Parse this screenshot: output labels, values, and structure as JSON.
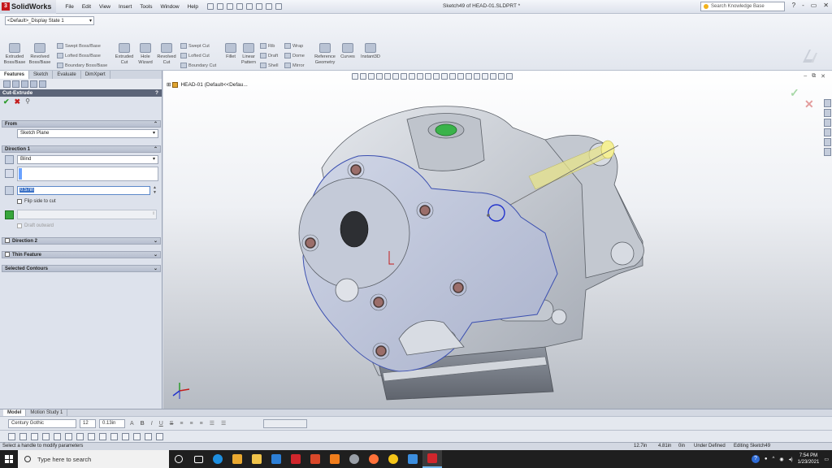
{
  "app": {
    "brand": "SolidWorks",
    "document_title": "Sketch49 of HEAD-01.SLDPRT *",
    "menu": [
      "File",
      "Edit",
      "View",
      "Insert",
      "Tools",
      "Window",
      "Help"
    ],
    "search_placeholder": "Search Knowledge Base",
    "window_controls": [
      "?",
      "-",
      "▭",
      "✕"
    ]
  },
  "config": {
    "display_state": "<Default>_Display State 1"
  },
  "command_manager": {
    "extruded_boss": "Extruded Boss/Base",
    "revolved_boss": "Revolved Boss/Base",
    "swept_boss": "Swept Boss/Base",
    "lofted_boss": "Lofted Boss/Base",
    "boundary_boss": "Boundary Boss/Base",
    "extruded_cut": "Extruded Cut",
    "hole_wizard": "Hole Wizard",
    "revolved_cut": "Revolved Cut",
    "swept_cut": "Swept Cut",
    "lofted_cut": "Lofted Cut",
    "boundary_cut": "Boundary Cut",
    "fillet": "Fillet",
    "linear_pattern": "Linear Pattern",
    "rib": "Rib",
    "draft": "Draft",
    "shell": "Shell",
    "wrap": "Wrap",
    "dome": "Dome",
    "mirror": "Mirror",
    "reference_geometry": "Reference Geometry",
    "curves": "Curves",
    "instant3d": "Instant3D"
  },
  "panel": {
    "tabs": [
      "Features",
      "Sketch",
      "Evaluate",
      "DimXpert"
    ],
    "active_tab": "Features",
    "title": "Cut-Extrude",
    "help": "?",
    "from": {
      "header": "From",
      "value": "Sketch Plane"
    },
    "direction1": {
      "header": "Direction 1",
      "end_condition": "Blind",
      "depth": "0.57in",
      "flip_side_label": "Flip side to cut",
      "draft_label": "Draft outward"
    },
    "direction2_header": "Direction 2",
    "thin_feature_header": "Thin Feature",
    "selected_contours_header": "Selected Contours"
  },
  "viewport": {
    "tree_label": "HEAD-01  (Default<<Defau..."
  },
  "bottom_tabs": [
    "Model",
    "Motion Study 1"
  ],
  "format_bar": {
    "font": "Century Gothic",
    "size": "12",
    "height": "0.13in",
    "style_buttons": [
      "A",
      "B",
      "I",
      "U",
      "S"
    ]
  },
  "status": {
    "message": "Select a handle to modify parameters",
    "x": "12.7in",
    "y": "4.81in",
    "z": "0in",
    "definition": "Under Defined",
    "editing": "Editing Sketch49"
  },
  "taskbar": {
    "search_placeholder": "Type here to search",
    "time": "7:54 PM",
    "date": "1/23/2021"
  },
  "colors": {
    "accent_blue": "#3d73c7",
    "confirm_green": "#2c9b2c",
    "cancel_red": "#c31c1c",
    "model_face": "#c5cad4",
    "selected_face": "#b8c0dc"
  }
}
